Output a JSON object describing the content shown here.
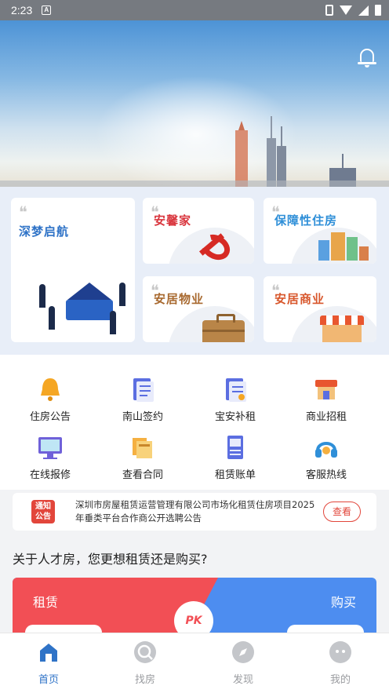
{
  "status_bar": {
    "time": "2:23",
    "notification_icon": "A"
  },
  "hero": {
    "bell_icon": "bell-icon"
  },
  "feature_cards": [
    {
      "title": "深梦启航",
      "icon": "graduation-illustration"
    },
    {
      "title": "安馨家",
      "icon": "hammer-sickle-icon"
    },
    {
      "title": "保障性住房",
      "icon": "buildings-icon"
    },
    {
      "title": "安居物业",
      "icon": "briefcase-icon"
    },
    {
      "title": "安居商业",
      "icon": "shop-icon"
    }
  ],
  "services": [
    {
      "label": "住房公告",
      "icon": "bell-icon",
      "color": "#f5a623"
    },
    {
      "label": "南山签约",
      "icon": "contract-icon",
      "color": "#5b6ee1"
    },
    {
      "label": "宝安补租",
      "icon": "document-icon",
      "color": "#5b6ee1"
    },
    {
      "label": "商业招租",
      "icon": "shop-icon",
      "color": "#e8562f"
    },
    {
      "label": "在线报修",
      "icon": "monitor-icon",
      "color": "#6f61d9"
    },
    {
      "label": "查看合同",
      "icon": "folder-icon",
      "color": "#f5b041"
    },
    {
      "label": "租赁账单",
      "icon": "bill-icon",
      "color": "#5b6ee1"
    },
    {
      "label": "客服热线",
      "icon": "headset-icon",
      "color": "#2f8fd8"
    }
  ],
  "notice": {
    "badge": "通知公告",
    "text": "深圳市房屋租赁运营管理有限公司市场化租赁住房项目2025年垂类平台合作商公开选聘公告",
    "view_label": "查看"
  },
  "question": "关于人才房，您更想租赁还是购买?",
  "pk": {
    "rent_label": "租赁",
    "buy_label": "购买",
    "pk_label": "PK"
  },
  "tabs": [
    {
      "label": "首页",
      "icon": "home-icon",
      "active": true
    },
    {
      "label": "找房",
      "icon": "search-house-icon",
      "active": false
    },
    {
      "label": "发现",
      "icon": "compass-icon",
      "active": false
    },
    {
      "label": "我的",
      "icon": "profile-icon",
      "active": false
    }
  ],
  "colors": {
    "accent": "#2f73c7",
    "red": "#f24f55",
    "blue": "#4d8df0"
  }
}
